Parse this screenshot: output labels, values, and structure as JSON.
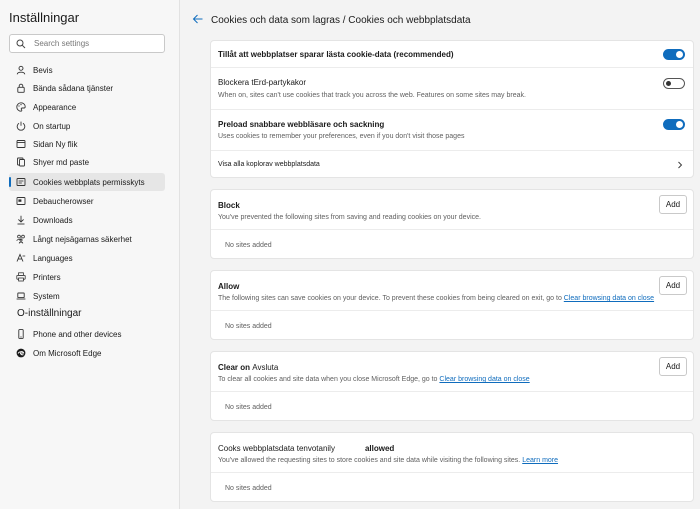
{
  "sidebar": {
    "title": "Inställningar",
    "search_placeholder": "Search settings",
    "items": [
      {
        "label": "Bevis",
        "icon": "user-icon"
      },
      {
        "label": "Bända sådana tjänster",
        "icon": "lock-icon"
      },
      {
        "label": "Appearance",
        "icon": "palette-icon"
      },
      {
        "label": "On startup",
        "icon": "power-icon"
      },
      {
        "label": "Sidan Ny flik",
        "icon": "new-tab-icon"
      },
      {
        "label": "Shyer md paste",
        "icon": "share-icon"
      },
      {
        "label": "Cookies webbplats permisskyts",
        "icon": "cookies-icon",
        "active": true
      },
      {
        "label": "Debaucherowser",
        "icon": "browser-icon"
      },
      {
        "label": "Downloads",
        "icon": "download-icon"
      },
      {
        "label": "Långt nejsägarnas säkerhet",
        "icon": "family-icon"
      },
      {
        "label": "Languages",
        "icon": "languages-icon"
      },
      {
        "label": "Printers",
        "icon": "printer-icon"
      },
      {
        "label": "System",
        "icon": "laptop-icon"
      }
    ],
    "section2_title": "O-inställningar",
    "items2": [
      {
        "label": "Phone and other devices",
        "icon": "phone-icon"
      },
      {
        "label": "Om Microsoft Edge",
        "icon": "edge-icon"
      }
    ]
  },
  "main": {
    "breadcrumb": "Cookies och data som lagras / Cookies och webbplatsdata",
    "settings": [
      {
        "title": "Tillåt att webbplatser sparar lästa cookie-data",
        "suffix": "(recommended)",
        "state": "on"
      },
      {
        "title": "Blockera tErd-partykakor",
        "desc": "When on, sites can't use cookies that track you across the web. Features on some sites may break.",
        "state": "off"
      },
      {
        "title": "Preload snabbare webbläsare och sackning",
        "desc": "Uses cookies to remember your preferences, even if you don't visit those pages",
        "state": "on"
      },
      {
        "title": "Visa alla koplorav webbplatsdata"
      }
    ],
    "block": {
      "title": "Block",
      "desc": "You've prevented the following sites from saving and reading cookies on your device.",
      "add": "Add",
      "empty": "No sites added"
    },
    "allow": {
      "title": "Allow",
      "desc": "The following sites can save cookies on your device. To prevent these cookies from being cleared on exit, go to",
      "link": "Clear browsing data on close",
      "add": "Add",
      "empty": "No sites added"
    },
    "clear": {
      "title": "Clear on",
      "title_suffix": "Avsluta",
      "desc": "To clear all cookies and site data when you close Microsoft Edge, go to",
      "link": "Clear browsing data on close",
      "add": "Add",
      "empty": "No sites added"
    },
    "third": {
      "title": "Cooks webbplatsdata tenvotanily",
      "title_suffix": "allowed",
      "desc": "You've allowed the requesting sites to store cookies and site data while visiting the following sites.",
      "link": "Learn more",
      "empty": "No sites added"
    }
  },
  "colors": {
    "accent": "#0f6cbd",
    "background": "#f3f3f3",
    "card": "#ffffff"
  }
}
